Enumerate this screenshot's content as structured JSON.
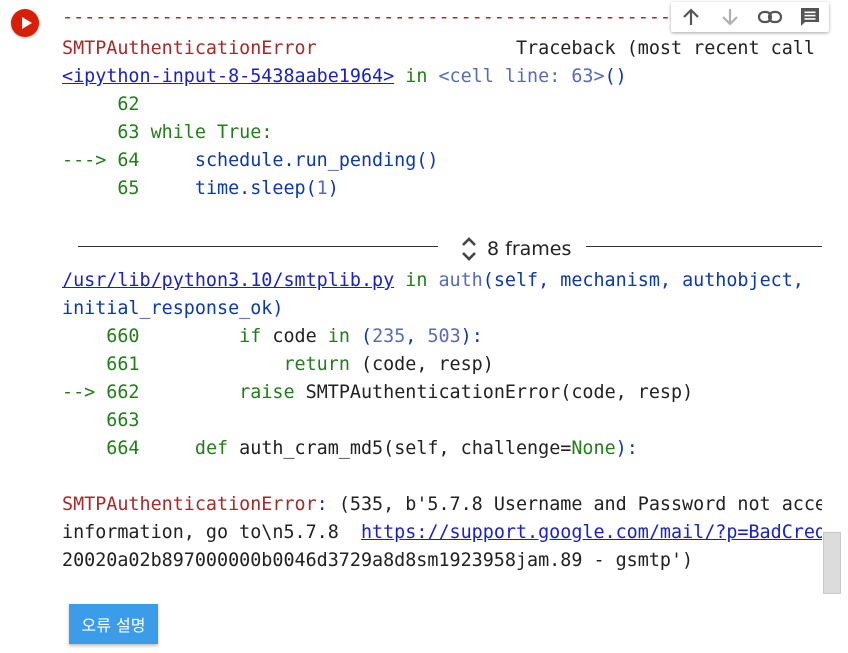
{
  "run_button": {
    "icon": "play-icon"
  },
  "toolbar": {
    "up_icon": "arrow-up-icon",
    "down_icon": "arrow-down-icon",
    "link_icon": "link-icon",
    "comment_icon": "comment-icon"
  },
  "traceback": {
    "separator": "-----------------------------------------------------------------",
    "error_name": "SMTPAuthenticationError",
    "header_spacer": "                  ",
    "header_right": "Traceback (most recent call",
    "frame1": {
      "file_link": "<ipython-input-8-5438aabe1964>",
      "in_word": " in ",
      "location": "<cell line: 63>",
      "location_paren": "()",
      "lines": [
        {
          "prefix": "     62",
          "code": ""
        },
        {
          "prefix": "     63 ",
          "kw": "while",
          "rest": " True:"
        },
        {
          "prefix": "---> 64",
          "code": "     schedule.run_pending()"
        },
        {
          "prefix": "     65",
          "code_a": "     time.sleep(",
          "num": "1",
          "code_b": ")"
        }
      ]
    },
    "frames_toggle": {
      "label": "8 frames",
      "icon": "expand-collapse-icon"
    },
    "frame2": {
      "file_link": "/usr/lib/python3.10/smtplib.py",
      "in_word": " in ",
      "func": "auth",
      "args_line1": "(self, mechanism, authobject,",
      "args_line2": "initial_response_ok)",
      "lines": [
        {
          "prefix": "    660",
          "indent": "         ",
          "kw": "if",
          "rest_a": " code ",
          "kw2": "in",
          "rest_b": " (",
          "n1": "235",
          "sep": ", ",
          "n2": "503",
          "rest_c": "):"
        },
        {
          "prefix": "    661",
          "indent": "             ",
          "kw": "return",
          "rest": " (code, resp)"
        },
        {
          "prefix": "--> 662",
          "indent": "         ",
          "kw": "raise",
          "rest": " SMTPAuthenticationError(code, resp)"
        },
        {
          "prefix": "    663",
          "code": ""
        },
        {
          "prefix": "    664",
          "indent": "     ",
          "kw": "def",
          "rest_a": " auth_cram_md5(self, challenge=",
          "kw2": "None",
          "rest_b": "):"
        }
      ]
    },
    "message": {
      "name": "SMTPAuthenticationError",
      "colon": ":",
      "text1": " (535, b'5.7.8 Username and Password not acce",
      "text2_a": "information, go to\\n5.7.8  ",
      "text2_link": "https://support.google.com/mail/?p=BadCred",
      "text3": "20020a02b897000000b0046d3729a8d8sm1923958jam.89 - gsmtp')"
    }
  },
  "explain_button": {
    "label": "오류 설명"
  }
}
